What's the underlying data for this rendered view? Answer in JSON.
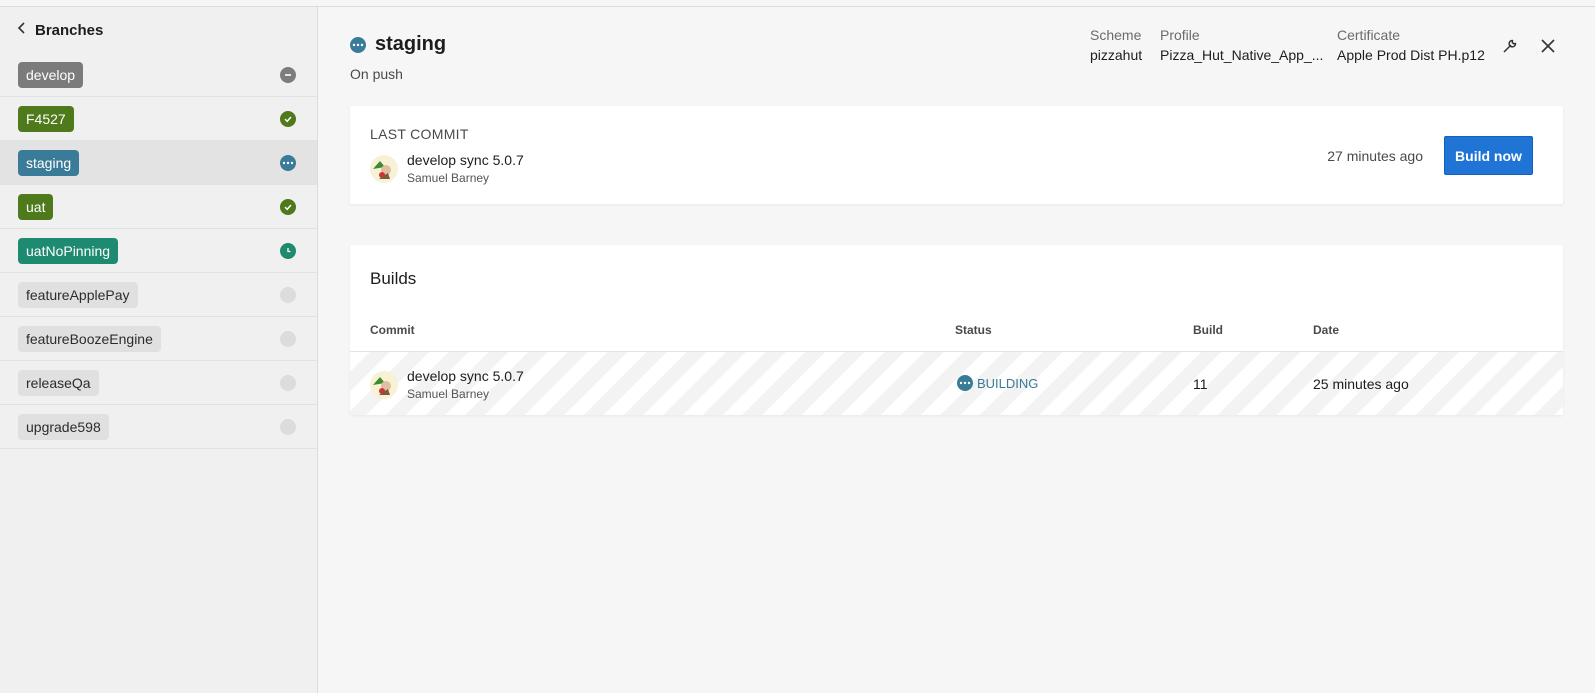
{
  "sidebar": {
    "header": "Branches",
    "items": [
      {
        "label": "develop",
        "status": "disabled"
      },
      {
        "label": "F4527",
        "status": "success"
      },
      {
        "label": "staging",
        "status": "building"
      },
      {
        "label": "uat",
        "status": "success"
      },
      {
        "label": "uatNoPinning",
        "status": "queued"
      },
      {
        "label": "featureApplePay",
        "status": "none"
      },
      {
        "label": "featureBoozeEngine",
        "status": "none"
      },
      {
        "label": "releaseQa",
        "status": "none"
      },
      {
        "label": "upgrade598",
        "status": "none"
      }
    ]
  },
  "header": {
    "title": "staging",
    "trigger": "On push",
    "scheme_label": "Scheme",
    "scheme_value": "pizzahut",
    "profile_label": "Profile",
    "profile_value": "Pizza_Hut_Native_App_...",
    "certificate_label": "Certificate",
    "certificate_value": "Apple Prod Dist PH.p12"
  },
  "last_commit": {
    "label": "LAST COMMIT",
    "message": "develop sync 5.0.7",
    "author": "Samuel Barney",
    "time_ago": "27 minutes ago",
    "build_button": "Build now"
  },
  "builds": {
    "title": "Builds",
    "columns": [
      "Commit",
      "Status",
      "Build",
      "Date"
    ],
    "rows": [
      {
        "message": "develop sync 5.0.7",
        "author": "Samuel Barney",
        "status": "BUILDING",
        "build": "11",
        "date": "25 minutes ago"
      }
    ]
  },
  "colors": {
    "accent": "#1f74d6",
    "building": "#3a7b98",
    "success": "#4e7a1c",
    "queued": "#1e8a70"
  }
}
